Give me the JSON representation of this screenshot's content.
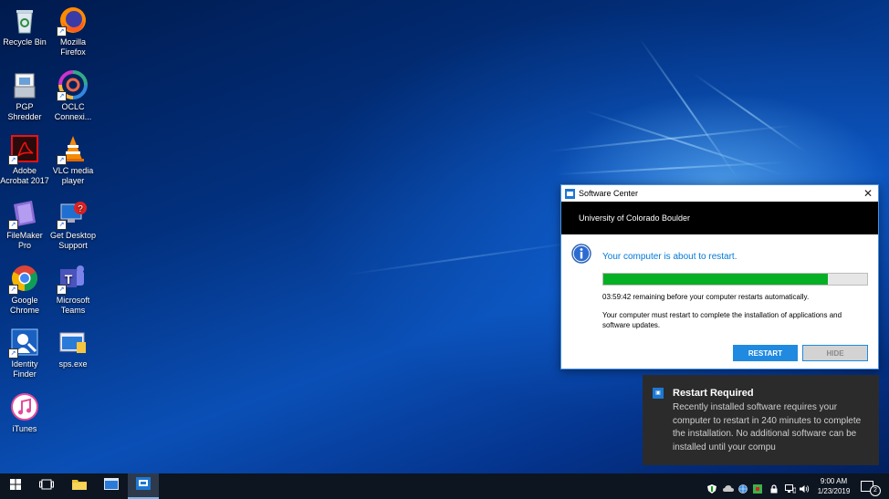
{
  "desktop": {
    "icons": [
      {
        "label": "Recycle Bin",
        "icon": "recycle-bin-icon"
      },
      {
        "label": "Mozilla Firefox",
        "icon": "firefox-icon"
      },
      {
        "label": "PGP Shredder",
        "icon": "pgp-shredder-icon"
      },
      {
        "label": "OCLC Connexi...",
        "icon": "oclc-icon"
      },
      {
        "label": "Adobe Acrobat 2017",
        "icon": "acrobat-icon"
      },
      {
        "label": "VLC media player",
        "icon": "vlc-icon"
      },
      {
        "label": "FileMaker Pro",
        "icon": "filemaker-icon"
      },
      {
        "label": "Get Desktop Support",
        "icon": "desktop-support-icon"
      },
      {
        "label": "Google Chrome",
        "icon": "chrome-icon"
      },
      {
        "label": "Microsoft Teams",
        "icon": "teams-icon"
      },
      {
        "label": "Identity Finder",
        "icon": "identity-finder-icon"
      },
      {
        "label": "sps.exe",
        "icon": "sps-exe-icon"
      },
      {
        "label": "iTunes",
        "icon": "itunes-icon"
      }
    ]
  },
  "window": {
    "title": "Software Center",
    "banner": "University of Colorado Boulder",
    "headline": "Your computer is about to restart.",
    "progress": 0.85,
    "remaining": "03:59:42 remaining before your computer restarts automatically.",
    "message": "Your computer must restart to complete the installation of applications and software updates.",
    "restart_label": "RESTART",
    "hide_label": "HIDE",
    "accent": "#0078d7",
    "progress_color": "#06b025"
  },
  "toast": {
    "title": "Restart Required",
    "body": "Recently installed software requires your computer to restart in 240 minutes to complete the installation. No additional software can be installed until your compu"
  },
  "taskbar": {
    "time": "9:00 AM",
    "date": "1/23/2019",
    "notification_count": "2"
  }
}
